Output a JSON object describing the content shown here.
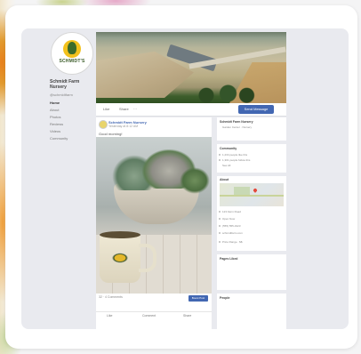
{
  "colors": {
    "facebook_blue": "#4267b2",
    "page_bg": "#e9eaef",
    "card_bg": "#ffffff"
  },
  "sidebar": {
    "logo_text": "SCHMIDT'S",
    "page_name": "Schmidt Farm Nursery",
    "handle": "@schmidtfarm",
    "nav_items": [
      {
        "label": "Home"
      },
      {
        "label": "About"
      },
      {
        "label": "Photos"
      },
      {
        "label": "Reviews"
      },
      {
        "label": "Videos"
      },
      {
        "label": "Community"
      }
    ]
  },
  "action_bar": {
    "like_label": "Like",
    "share_label": "Share",
    "more_label": "···",
    "cta_label": "Send Message"
  },
  "post": {
    "author": "Schmidt Farm Nursery",
    "time": "Yesterday at 8:12 AM",
    "text": "Good morning!",
    "stats": "32 · 4 Comments",
    "cta_label": "Boost Post",
    "actions": {
      "like": "Like",
      "comment": "Comment",
      "share": "Share"
    }
  },
  "right_column": {
    "about_title": "Schmidt Farm Nursery",
    "about_sub": "Garden Center · Nursery",
    "community_title": "Community",
    "community_lines": [
      "1,234 people like this",
      "1,301 people follow this",
      "See All"
    ],
    "about_section_title": "About",
    "about_lines": [
      "123 Farm Road",
      "Open Now",
      "(555) 555-0123",
      "schmidtfarm.com",
      "Price Range · $$"
    ],
    "pages_liked_title": "Pages Liked",
    "people_title": "People"
  }
}
